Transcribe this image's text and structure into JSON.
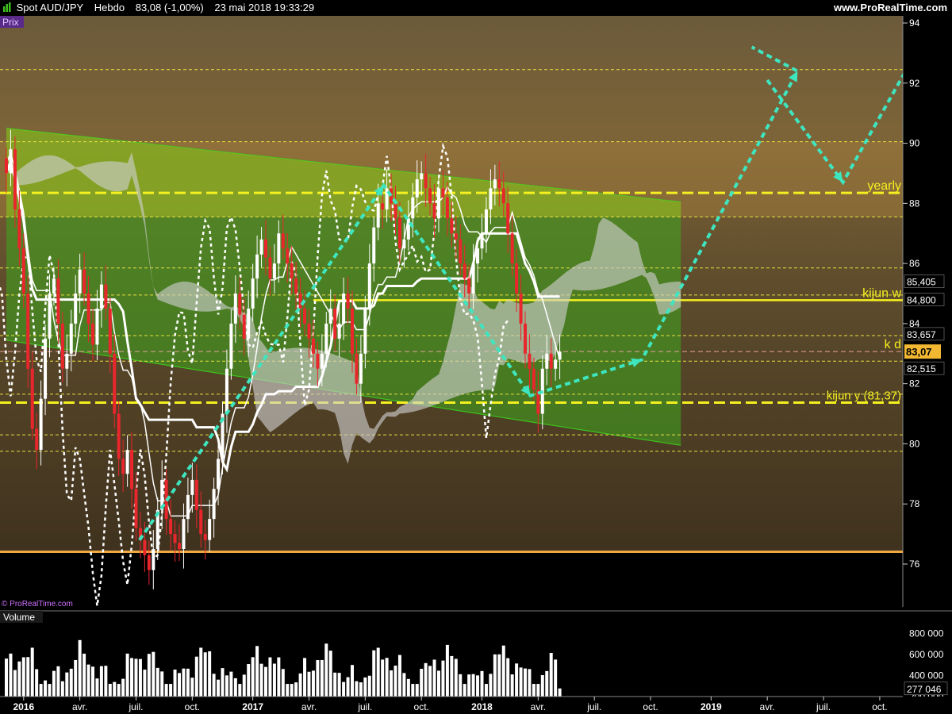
{
  "header": {
    "instrument": "Spot AUD/JPY",
    "period": "Hebdo",
    "price_change": "83,08 (-1,00%)",
    "datetime": "23 mai 2018 19:33:29",
    "site": "www.ProRealTime.com"
  },
  "panels": {
    "price_label": "Prix",
    "volume_label": "Volume",
    "watermark": "© ProRealTime.com"
  },
  "colors": {
    "up": "#ffffff",
    "down": "#e8262c",
    "arrow": "#3ee6c0",
    "yellow": "#f5f020",
    "orange": "#f2a840",
    "channel": "#3ec11e"
  },
  "chart_data": [
    {
      "type": "candlestick",
      "title": "",
      "xlabel": "",
      "ylabel": "",
      "ylim": [
        74.5,
        94.3
      ],
      "y_ticks": [
        "94",
        "92",
        "90",
        "88",
        "86",
        "84",
        "82",
        "80",
        "78",
        "76"
      ],
      "x_ticks": [
        "2016",
        "avr.",
        "juil.",
        "oct.",
        "2017",
        "avr.",
        "juil.",
        "oct.",
        "2018",
        "avr.",
        "juil.",
        "oct.",
        "2019",
        "avr.",
        "juil.",
        "oct."
      ],
      "x_range": [
        "2016-01",
        "2019-10"
      ],
      "grid": false,
      "annotations": {
        "yearly": "yearly",
        "kijun_w": "kijun w",
        "k_d": "k d",
        "kijun_y": "kijun y (81,37)"
      },
      "price_labels": [
        {
          "text": "85,405",
          "value": 85.405,
          "highlight": false
        },
        {
          "text": "84,800",
          "value": 84.8,
          "highlight": false
        },
        {
          "text": "83,657",
          "value": 83.657,
          "highlight": false
        },
        {
          "text": "83,07",
          "value": 83.07,
          "highlight": true
        },
        {
          "text": "82,515",
          "value": 82.515,
          "highlight": false
        }
      ],
      "levels": [
        {
          "value": 88.35,
          "style": "thick-yellow-dash",
          "label": "yearly"
        },
        {
          "value": 84.78,
          "style": "thick-yellow-solid",
          "label": "kijun w"
        },
        {
          "value": 83.07,
          "style": "thin-pink-dash",
          "label": "k d"
        },
        {
          "value": 81.37,
          "style": "thick-yellow-dash",
          "label": "kijun y (81,37)"
        },
        {
          "value": 76.41,
          "style": "thick-orange-solid",
          "label": ""
        },
        {
          "value": 92.45,
          "style": "thin-yellow-dash",
          "label": ""
        },
        {
          "value": 90.05,
          "style": "thin-yellow-dash",
          "label": ""
        },
        {
          "value": 87.55,
          "style": "thin-yellow-dash",
          "label": ""
        },
        {
          "value": 85.85,
          "style": "thin-yellow-dash",
          "label": ""
        },
        {
          "value": 84.95,
          "style": "thin-yellow-dash",
          "label": ""
        },
        {
          "value": 83.6,
          "style": "thin-yellow-dash",
          "label": ""
        },
        {
          "value": 82.75,
          "style": "thin-yellow-dash",
          "label": ""
        },
        {
          "value": 81.65,
          "style": "thin-yellow-dash",
          "label": ""
        },
        {
          "value": 80.3,
          "style": "thin-yellow-dash",
          "label": ""
        },
        {
          "value": 79.75,
          "style": "thin-yellow-dash",
          "label": ""
        }
      ],
      "channel": {
        "upper": [
          [
            0,
            90.5
          ],
          [
            156,
            88.05
          ]
        ],
        "lower": [
          [
            0,
            83.45
          ],
          [
            156,
            79.95
          ]
        ]
      },
      "projection_arrows": [
        [
          [
            30.8,
            76.8
          ],
          [
            87.3,
            88.6
          ],
          [
            121.2,
            81.6
          ],
          [
            147,
            82.8
          ],
          [
            183,
            92.4
          ],
          [
            172.4,
            93.2
          ]
        ],
        [
          [
            176,
            92.1
          ],
          [
            193.5,
            88.7
          ],
          [
            215,
            94.2
          ]
        ]
      ],
      "closes": [
        89.0,
        89.8,
        87.8,
        86.5,
        85.0,
        82.5,
        80.5,
        79.8,
        81.5,
        83.5,
        85.0,
        85.5,
        84.0,
        82.5,
        83.0,
        84.0,
        85.0,
        85.8,
        85.0,
        84.0,
        83.3,
        84.5,
        85.3,
        84.5,
        83.0,
        81.0,
        79.5,
        79.0,
        79.8,
        78.5,
        77.2,
        76.8,
        76.3,
        75.8,
        76.5,
        77.8,
        78.8,
        77.5,
        77.0,
        76.7,
        76.5,
        77.5,
        78.3,
        78.8,
        77.8,
        77.0,
        76.8,
        77.5,
        78.5,
        79.5,
        81.0,
        82.5,
        84.0,
        85.0,
        84.3,
        83.5,
        84.5,
        85.5,
        86.3,
        86.8,
        86.2,
        85.5,
        86.0,
        87.0,
        86.5,
        86.0,
        85.5,
        85.0,
        84.5,
        84.0,
        83.5,
        83.0,
        82.5,
        83.0,
        84.0,
        84.5,
        83.5,
        84.0,
        85.0,
        84.5,
        83.0,
        82.0,
        83.0,
        84.5,
        86.0,
        87.2,
        88.0,
        87.8,
        88.5,
        88.0,
        87.5,
        86.5,
        86.8,
        87.5,
        88.2,
        88.8,
        89.0,
        88.5,
        88.0,
        87.5,
        88.5,
        88.2,
        87.5,
        87.0,
        86.8,
        86.0,
        85.5,
        85.0,
        86.0,
        86.5,
        87.0,
        87.8,
        88.5,
        88.8,
        88.5,
        88.0,
        87.0,
        86.0,
        85.0,
        84.0,
        83.0,
        82.5,
        81.8,
        81.0,
        82.5,
        83.0,
        82.5,
        82.8,
        83.07
      ],
      "volume": {
        "ylim": [
          200000,
          900000
        ],
        "y_ticks": [
          "800 000",
          "600 000",
          "400 000",
          "200 000"
        ],
        "last_label": "277 046",
        "last_value": 277046
      }
    }
  ]
}
